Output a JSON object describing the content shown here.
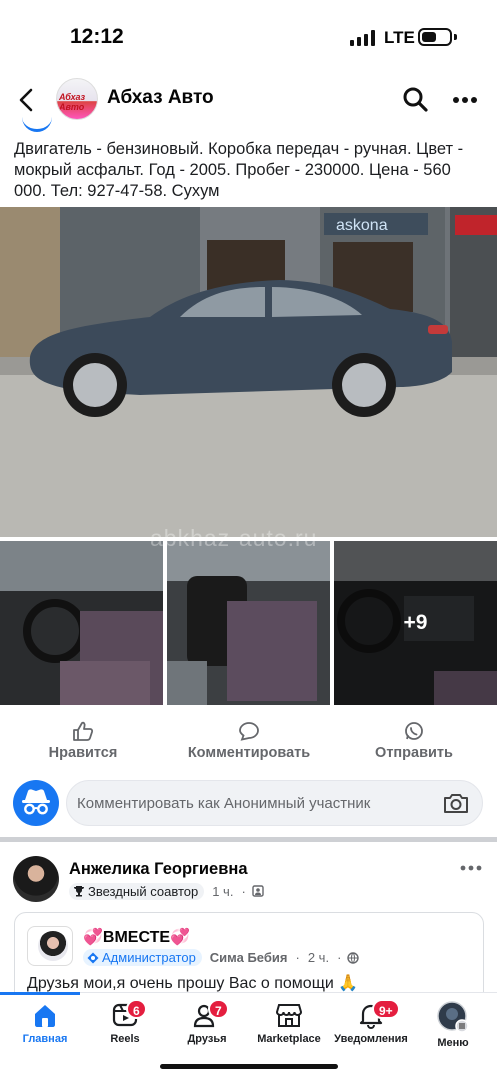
{
  "status_bar": {
    "time": "12:12",
    "network": "LTE"
  },
  "header": {
    "title": "Абхаз Авто",
    "avatar_text": "Абхаз Авто"
  },
  "post": {
    "text": "Двигатель - бензиновый. Коробка передач - ручная. Цвет - мокрый асфальт. Год - 2005. Пробег - 230000. Цена - 560 000. Тел: 927-47-58. Сухум",
    "main_photo_sign": "askona",
    "watermark": "abkhaz-auto.ru",
    "more_photos": "+9",
    "actions": {
      "like": "Нравится",
      "comment": "Комментировать",
      "send": "Отправить"
    },
    "comment_placeholder": "Комментировать как Анонимный участник"
  },
  "post2": {
    "author": "Анжелика Георгиевна",
    "badge": "Звездный соавтор",
    "time": "1 ч.",
    "shared": {
      "group_name": "💞ВМЕСТЕ💞",
      "role": "Администратор",
      "author": "Сима Бебия",
      "time": "2 ч.",
      "text": "Друзья мои,я очень прошу Вас о помощи 🙏"
    }
  },
  "tab_bar": {
    "home": "Главная",
    "reels": "Reels",
    "reels_badge": "6",
    "friends": "Друзья",
    "friends_badge": "7",
    "marketplace": "Marketplace",
    "notifications": "Уведомления",
    "notifications_badge": "9+",
    "menu": "Меню"
  },
  "colors": {
    "accent": "#1877f2",
    "badge": "#e41e3f",
    "secondary_text": "#65676b"
  }
}
